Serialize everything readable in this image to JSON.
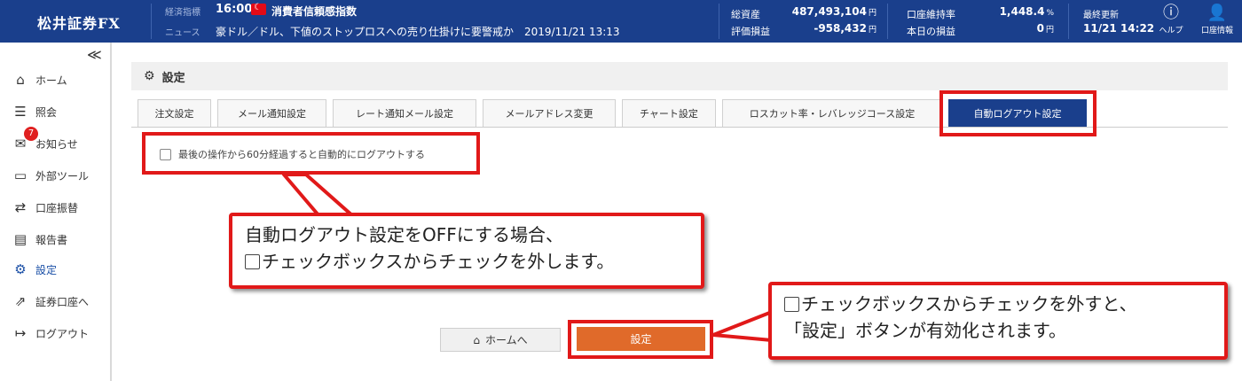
{
  "header": {
    "logo": "松井証券FX",
    "ticker_label": "経済指標",
    "ticker_time": "16:00",
    "ticker_title": "消費者信頼感指数",
    "news_label": "ニュース",
    "news_text": "豪ドル／ドル、下値のストップロスへの売り仕掛けに要警戒か　2019/11/21 13:13",
    "account": [
      {
        "label": "総資産",
        "value": "487,493,104",
        "unit": "円"
      },
      {
        "label": "評価損益",
        "value": "-958,432",
        "unit": "円"
      },
      {
        "label": "口座維持率",
        "value": "1,448.4",
        "unit": "%"
      },
      {
        "label": "本日の損益",
        "value": "0",
        "unit": "円"
      }
    ],
    "last_update_label": "最終更新",
    "last_update_value": "11/21 14:22",
    "help_label": "ヘルプ",
    "account_info_label": "口座情報"
  },
  "sidebar": {
    "collapse": "≪",
    "items": [
      {
        "label": "ホーム",
        "icon": "home-icon"
      },
      {
        "label": "照会",
        "icon": "list-icon"
      },
      {
        "label": "お知らせ",
        "icon": "mail-icon",
        "badge": "7"
      },
      {
        "label": "外部ツール",
        "icon": "monitor-icon"
      },
      {
        "label": "口座振替",
        "icon": "transfer-icon"
      },
      {
        "label": "報告書",
        "icon": "document-icon"
      },
      {
        "label": "設定",
        "icon": "gear-icon",
        "active": true
      },
      {
        "label": "証券口座へ",
        "icon": "external-link-icon"
      },
      {
        "label": "ログアウト",
        "icon": "logout-icon"
      }
    ]
  },
  "page": {
    "title": "設定",
    "tabs": [
      {
        "label": "注文設定"
      },
      {
        "label": "メール通知設定"
      },
      {
        "label": "レート通知メール設定"
      },
      {
        "label": "メールアドレス変更"
      },
      {
        "label": "チャート設定"
      },
      {
        "label": "ロスカット率・レバレッジコース設定"
      },
      {
        "label": "自動ログアウト設定",
        "active": true
      }
    ],
    "checkbox_label": "最後の操作から60分経過すると自動的にログアウトする",
    "home_button": "ホームへ",
    "submit_button": "設定"
  },
  "annotations": {
    "callout1_line1": "自動ログアウト設定をOFFにする場合、",
    "callout1_line2": "チェックボックスからチェックを外します。",
    "callout2_line1": "チェックボックスからチェックを外すと、",
    "callout2_line2": "「設定」ボタンが有効化されます。"
  },
  "colors": {
    "header_bg": "#1a3f8c",
    "active_tab": "#1a3f8c",
    "submit_button": "#e06a2a",
    "annotation_red": "#e11919",
    "badge": "#e02020"
  }
}
